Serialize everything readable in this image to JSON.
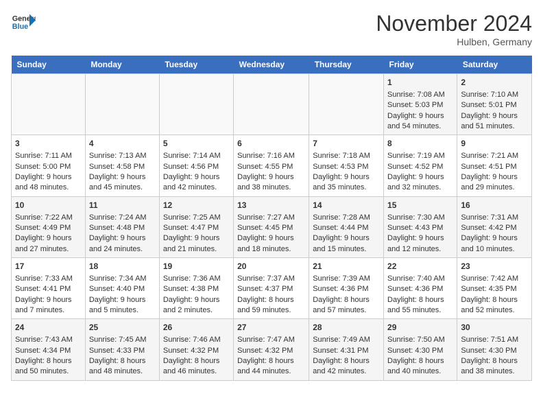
{
  "logo": {
    "general": "General",
    "blue": "Blue"
  },
  "title": "November 2024",
  "location": "Hulben, Germany",
  "days_header": [
    "Sunday",
    "Monday",
    "Tuesday",
    "Wednesday",
    "Thursday",
    "Friday",
    "Saturday"
  ],
  "weeks": [
    [
      {
        "day": "",
        "info": ""
      },
      {
        "day": "",
        "info": ""
      },
      {
        "day": "",
        "info": ""
      },
      {
        "day": "",
        "info": ""
      },
      {
        "day": "",
        "info": ""
      },
      {
        "day": "1",
        "info": "Sunrise: 7:08 AM\nSunset: 5:03 PM\nDaylight: 9 hours and 54 minutes."
      },
      {
        "day": "2",
        "info": "Sunrise: 7:10 AM\nSunset: 5:01 PM\nDaylight: 9 hours and 51 minutes."
      }
    ],
    [
      {
        "day": "3",
        "info": "Sunrise: 7:11 AM\nSunset: 5:00 PM\nDaylight: 9 hours and 48 minutes."
      },
      {
        "day": "4",
        "info": "Sunrise: 7:13 AM\nSunset: 4:58 PM\nDaylight: 9 hours and 45 minutes."
      },
      {
        "day": "5",
        "info": "Sunrise: 7:14 AM\nSunset: 4:56 PM\nDaylight: 9 hours and 42 minutes."
      },
      {
        "day": "6",
        "info": "Sunrise: 7:16 AM\nSunset: 4:55 PM\nDaylight: 9 hours and 38 minutes."
      },
      {
        "day": "7",
        "info": "Sunrise: 7:18 AM\nSunset: 4:53 PM\nDaylight: 9 hours and 35 minutes."
      },
      {
        "day": "8",
        "info": "Sunrise: 7:19 AM\nSunset: 4:52 PM\nDaylight: 9 hours and 32 minutes."
      },
      {
        "day": "9",
        "info": "Sunrise: 7:21 AM\nSunset: 4:51 PM\nDaylight: 9 hours and 29 minutes."
      }
    ],
    [
      {
        "day": "10",
        "info": "Sunrise: 7:22 AM\nSunset: 4:49 PM\nDaylight: 9 hours and 27 minutes."
      },
      {
        "day": "11",
        "info": "Sunrise: 7:24 AM\nSunset: 4:48 PM\nDaylight: 9 hours and 24 minutes."
      },
      {
        "day": "12",
        "info": "Sunrise: 7:25 AM\nSunset: 4:47 PM\nDaylight: 9 hours and 21 minutes."
      },
      {
        "day": "13",
        "info": "Sunrise: 7:27 AM\nSunset: 4:45 PM\nDaylight: 9 hours and 18 minutes."
      },
      {
        "day": "14",
        "info": "Sunrise: 7:28 AM\nSunset: 4:44 PM\nDaylight: 9 hours and 15 minutes."
      },
      {
        "day": "15",
        "info": "Sunrise: 7:30 AM\nSunset: 4:43 PM\nDaylight: 9 hours and 12 minutes."
      },
      {
        "day": "16",
        "info": "Sunrise: 7:31 AM\nSunset: 4:42 PM\nDaylight: 9 hours and 10 minutes."
      }
    ],
    [
      {
        "day": "17",
        "info": "Sunrise: 7:33 AM\nSunset: 4:41 PM\nDaylight: 9 hours and 7 minutes."
      },
      {
        "day": "18",
        "info": "Sunrise: 7:34 AM\nSunset: 4:40 PM\nDaylight: 9 hours and 5 minutes."
      },
      {
        "day": "19",
        "info": "Sunrise: 7:36 AM\nSunset: 4:38 PM\nDaylight: 9 hours and 2 minutes."
      },
      {
        "day": "20",
        "info": "Sunrise: 7:37 AM\nSunset: 4:37 PM\nDaylight: 8 hours and 59 minutes."
      },
      {
        "day": "21",
        "info": "Sunrise: 7:39 AM\nSunset: 4:36 PM\nDaylight: 8 hours and 57 minutes."
      },
      {
        "day": "22",
        "info": "Sunrise: 7:40 AM\nSunset: 4:36 PM\nDaylight: 8 hours and 55 minutes."
      },
      {
        "day": "23",
        "info": "Sunrise: 7:42 AM\nSunset: 4:35 PM\nDaylight: 8 hours and 52 minutes."
      }
    ],
    [
      {
        "day": "24",
        "info": "Sunrise: 7:43 AM\nSunset: 4:34 PM\nDaylight: 8 hours and 50 minutes."
      },
      {
        "day": "25",
        "info": "Sunrise: 7:45 AM\nSunset: 4:33 PM\nDaylight: 8 hours and 48 minutes."
      },
      {
        "day": "26",
        "info": "Sunrise: 7:46 AM\nSunset: 4:32 PM\nDaylight: 8 hours and 46 minutes."
      },
      {
        "day": "27",
        "info": "Sunrise: 7:47 AM\nSunset: 4:32 PM\nDaylight: 8 hours and 44 minutes."
      },
      {
        "day": "28",
        "info": "Sunrise: 7:49 AM\nSunset: 4:31 PM\nDaylight: 8 hours and 42 minutes."
      },
      {
        "day": "29",
        "info": "Sunrise: 7:50 AM\nSunset: 4:30 PM\nDaylight: 8 hours and 40 minutes."
      },
      {
        "day": "30",
        "info": "Sunrise: 7:51 AM\nSunset: 4:30 PM\nDaylight: 8 hours and 38 minutes."
      }
    ]
  ]
}
